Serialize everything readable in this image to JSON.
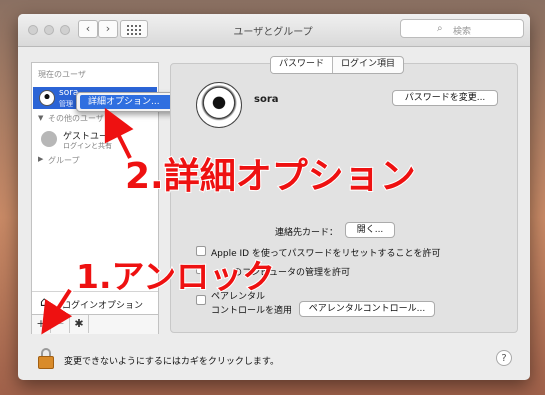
{
  "window": {
    "title": "ユーザとグループ"
  },
  "toolbar": {
    "back_glyph": "‹",
    "forward_glyph": "›",
    "search_placeholder": "検索",
    "search_icon": "search-icon"
  },
  "sidebar": {
    "current_users_label": "現在のユーザ",
    "current_user": {
      "name": "sora",
      "role": "管理"
    },
    "other_users_label": "その他のユーザ",
    "guest_user": {
      "name": "ゲストユー",
      "subtitle": "ログインと共有"
    },
    "groups_label": "グループ",
    "login_options_label": "ログインオプション",
    "add_glyph": "+",
    "remove_glyph": "−",
    "gear_glyph": "✱"
  },
  "context_menu": {
    "item": "詳細オプション..."
  },
  "tabs": [
    {
      "label": "パスワード",
      "selected": true
    },
    {
      "label": "ログイン項目",
      "selected": false
    }
  ],
  "main": {
    "username": "sora",
    "change_password_button": "パスワードを変更...",
    "contact_card_label": "連絡先カード：",
    "open_button": "開く...",
    "apple_id_reset_text": "Apple ID を使ってパスワードをリセットすることを許可",
    "admin_text": "のコンピュータの管理を許可",
    "parental_line1": "ペアレンタル",
    "parental_line2": "コントロールを適用",
    "parental_button": "ペアレンタルコントロール..."
  },
  "footer": {
    "lock_text": "変更できないようにするにはカギをクリックします。",
    "help_glyph": "?"
  },
  "annotations": {
    "step2": "2.詳細オプション",
    "step1": "1.アンロック",
    "color": "#ee1111"
  }
}
